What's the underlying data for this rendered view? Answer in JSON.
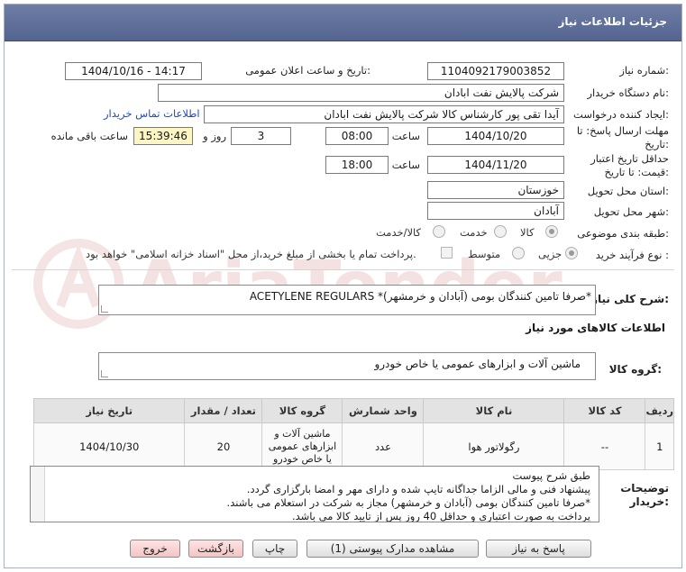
{
  "window": {
    "title": "جزئیات اطلاعات نیاز"
  },
  "fields": {
    "need_number_label": "شماره نیاز:",
    "need_number": "1104092179003852",
    "announce_label": "تاریخ و ساعت اعلان عمومی:",
    "announce_value": "1404/10/16 - 14:17",
    "buyer_label": "نام دستگاه خریدار:",
    "buyer_value": "شرکت پالایش نفت ابادان",
    "creator_label": "ایجاد کننده درخواست:",
    "creator_value": "آیدا تقی پور کارشناس کالا شرکت پالایش نفت ابادان",
    "contact_link": "اطلاعات تماس خریدار",
    "deadline_label": "مهلت ارسال پاسخ: تا تاریخ:",
    "deadline_date": "1404/10/20",
    "time_label": "ساعت",
    "deadline_time": "08:00",
    "days_value": "3",
    "days_label": "روز و",
    "remaining_time": "15:39:46",
    "remaining_label": "ساعت باقی مانده",
    "validity_label": "حداقل تاریخ اعتبار قیمت: تا تاریخ:",
    "validity_date": "1404/11/20",
    "validity_time": "18:00",
    "province_label": "استان محل تحویل:",
    "province_value": "خوزستان",
    "city_label": "شهر محل تحویل:",
    "city_value": "آبادان",
    "category_label": "طبقه بندی موضوعی:",
    "category_options": [
      "کالا",
      "خدمت",
      "کالا/خدمت"
    ],
    "process_label": "نوع فرآیند خرید :",
    "process_options": [
      "جزیی",
      "متوسط"
    ],
    "process_note": "پرداخت تمام یا بخشی از مبلغ خرید،از محل \"اسناد خزانه اسلامی\" خواهد بود."
  },
  "summary": {
    "label": "شرح کلی نیاز:",
    "value": "ACETYLENE REGULARS *صرفا تامین کنندگان بومی (آبادان و خرمشهر)*"
  },
  "goods_section_title": "اطلاعات کالاهای مورد نیاز",
  "goods_group": {
    "label": "گروه کالا:",
    "value": "ماشین آلات و ابزارهای عمومی یا خاص خودرو"
  },
  "table": {
    "headers": [
      "ردیف",
      "کد کالا",
      "نام کالا",
      "واحد شمارش",
      "گروه کالا",
      "تعداد / مقدار",
      "تاریخ نیاز"
    ],
    "rows": [
      [
        "1",
        "--",
        "رگولاتور هوا",
        "عدد",
        "ماشین آلات و ابزارهای عمومی یا خاص خودرو",
        "20",
        "1404/10/30"
      ]
    ]
  },
  "notes": {
    "label": "توضیحات خریدار:",
    "lines": [
      "طبق شرح پیوست",
      "پیشنهاد فنی و مالی الزاما جداگانه تایپ شده و دارای مهر و امضا بارگزاری گردد.",
      "*صرفا تامین کنندگان بومی (آبادان و خرمشهر) مجاز به شرکت در استعلام می باشند.",
      "پرداخت به صورت اعتباری و حداقل 40 روز پس از تایید کالا می باشد."
    ]
  },
  "buttons": {
    "reply": "پاسخ به نیاز",
    "view_docs": "مشاهده مدارک پیوستی (1)",
    "print": "چاپ",
    "back": "بازگشت",
    "exit": "خروج"
  },
  "watermark": "AriaTender.net"
}
